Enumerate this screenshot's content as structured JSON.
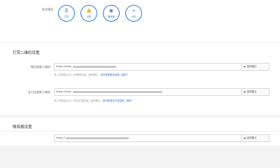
{
  "style_preview": {
    "label": "样式预览",
    "buttons": [
      {
        "label": "打赏",
        "icon": "bitcoin-icon",
        "glyph": "₿"
      },
      {
        "label": "点赞",
        "icon": "thumbs-up-icon",
        "glyph": "👍"
      },
      {
        "label": "微海报",
        "icon": "poster-icon",
        "glyph": "▣"
      },
      {
        "label": "分享",
        "icon": "share-icon",
        "glyph": "⋖"
      }
    ]
  },
  "reward_qr": {
    "title": "打赏二维码设置",
    "wechat": {
      "label": "微信收款二维码",
      "value": "https://www.",
      "pick_label": "选择图片",
      "hint_text": "请上传宽高比为1:1的微信收款二维码图片，",
      "hint_link": "如何获取微信收款二维码？"
    },
    "alipay": {
      "label": "支付宝收款二维码",
      "value": "https://www.",
      "pick_label": "选择图片",
      "hint_text": "请上传宽高比为1:1的支付宝收款二维码图片，",
      "hint_link": "如何获取支付宝收款二维码？"
    }
  },
  "poster": {
    "title": "微海报设置",
    "field": {
      "value": "https://",
      "pick_label": "选择图片"
    }
  },
  "colors": {
    "accent": "#2d7bd4"
  }
}
